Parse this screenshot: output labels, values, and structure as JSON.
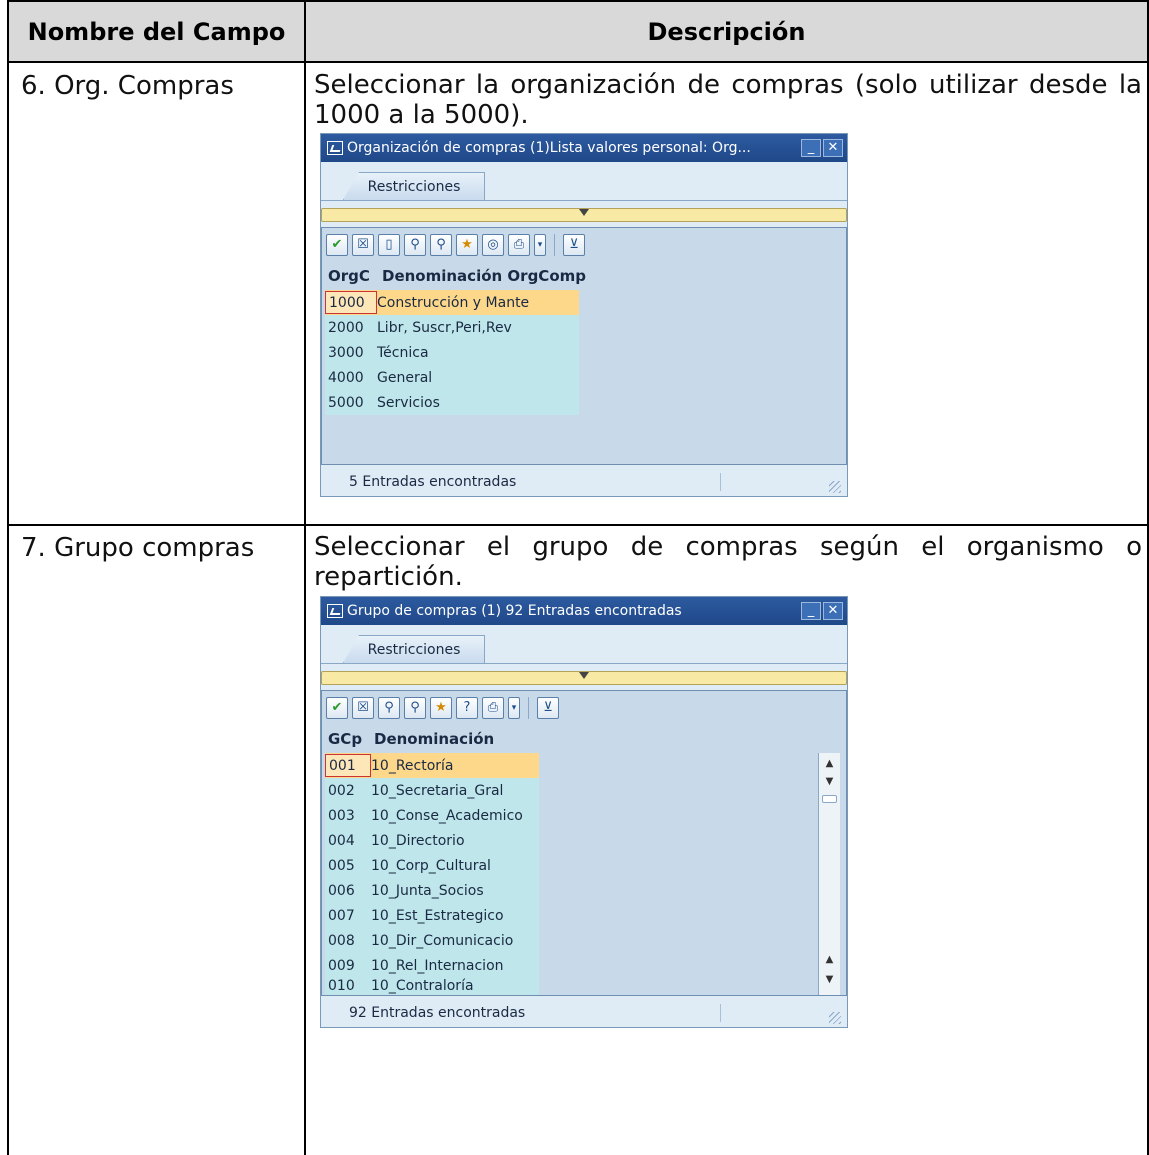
{
  "table": {
    "header_left": "Nombre del Campo",
    "header_right": "Descripción",
    "rows": [
      {
        "field": "6. Org. Compras",
        "description": "Seleccionar la organización de compras (solo utilizar desde la 1000 a la 5000)."
      },
      {
        "field": "7. Grupo compras",
        "description": "Seleccionar el grupo de compras según el organismo o repartición."
      }
    ]
  },
  "dialog1": {
    "title": "Organización de compras (1)Lista valores personal: Org...",
    "tab": "Restricciones",
    "col_key": "OrgC",
    "col_name": "Denominación OrgComp",
    "rows": [
      {
        "key": "1000",
        "name": "Construcción y Mante"
      },
      {
        "key": "2000",
        "name": "Libr, Suscr,Peri,Rev"
      },
      {
        "key": "3000",
        "name": "Técnica"
      },
      {
        "key": "4000",
        "name": "General"
      },
      {
        "key": "5000",
        "name": "Servicios"
      }
    ],
    "status": "5 Entradas encontradas"
  },
  "dialog2": {
    "title": "Grupo de compras (1)  92 Entradas encontradas",
    "tab": "Restricciones",
    "col_key": "GCp",
    "col_name": "Denominación",
    "rows": [
      {
        "key": "001",
        "name": "10_Rectoría"
      },
      {
        "key": "002",
        "name": "10_Secretaria_Gral"
      },
      {
        "key": "003",
        "name": "10_Conse_Academico"
      },
      {
        "key": "004",
        "name": "10_Directorio"
      },
      {
        "key": "005",
        "name": "10_Corp_Cultural"
      },
      {
        "key": "006",
        "name": "10_Junta_Socios"
      },
      {
        "key": "007",
        "name": "10_Est_Estrategico"
      },
      {
        "key": "008",
        "name": "10_Dir_Comunicacio"
      },
      {
        "key": "009",
        "name": "10_Rel_Internacion"
      },
      {
        "key": "010",
        "name": "10_Contraloría"
      }
    ],
    "status": "92 Entradas encontradas"
  },
  "colors": {
    "header_bg": "#d9d9d9",
    "titlebar": "#1f4888",
    "dialog_bg": "#dfebf5",
    "grid_bg": "#c8daea",
    "row_bg": "#bfe6ea",
    "selected_row": "#fdd88a",
    "filter_bar": "#f8eaa5"
  },
  "icons": [
    "check-icon",
    "cancel-icon",
    "new-doc-icon",
    "find-icon",
    "find-next-icon",
    "favorite-icon",
    "info-icon",
    "print-icon",
    "dropdown-icon",
    "filter-icon",
    "scroll-up-icon",
    "scroll-down-icon"
  ]
}
